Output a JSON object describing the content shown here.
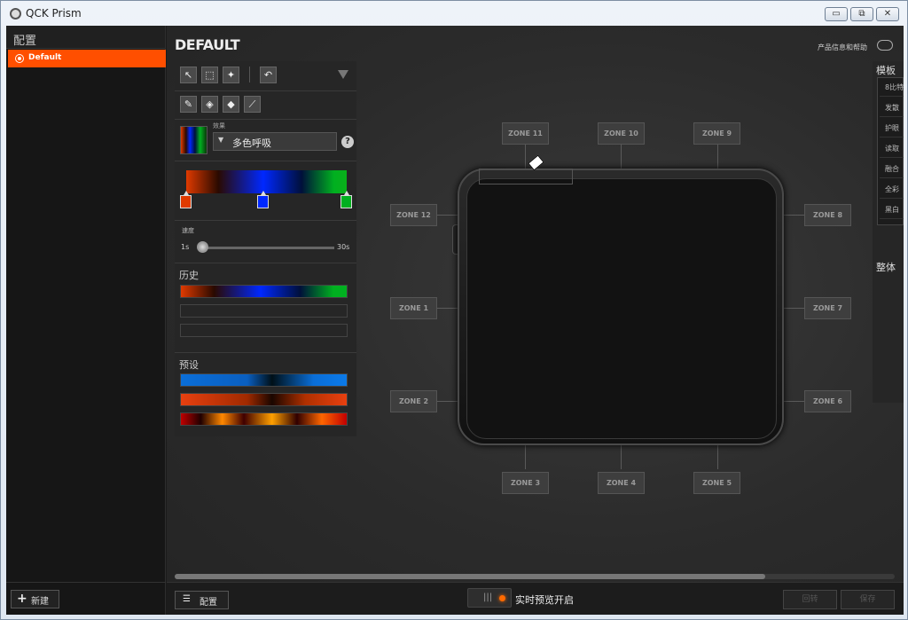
{
  "window": {
    "title": "QCK Prism",
    "minimize": "▭",
    "restore": "⧉",
    "close": "✕"
  },
  "sidebar": {
    "header": "配置",
    "items": [
      {
        "label": "Default",
        "selected": true
      }
    ],
    "new_button": "新建"
  },
  "main": {
    "title": "DEFAULT",
    "help_text": "产品信息和帮助",
    "effect": {
      "label": "效果",
      "value": "多色呼吸",
      "help": "?"
    },
    "gradient_stops": [
      {
        "color": "#e03a00",
        "position": 0.0
      },
      {
        "color": "#0028ff",
        "position": 0.48
      },
      {
        "color": "#00b020",
        "position": 1.0
      }
    ],
    "speed": {
      "label": "速度",
      "min": "1s",
      "max": "30s",
      "value_fraction": 0.0
    },
    "history": {
      "label": "历史"
    },
    "presets": {
      "label": "预设"
    },
    "config_button": "配置",
    "live_preview": "实时预览开启",
    "revert_button": "回转",
    "save_button": "保存",
    "scroll_fraction": 0.82
  },
  "zones": [
    "ZONE 11",
    "ZONE 10",
    "ZONE 9",
    "ZONE 12",
    "ZONE 8",
    "ZONE 1",
    "ZONE 7",
    "ZONE 2",
    "ZONE 6",
    "ZONE 3",
    "ZONE 4",
    "ZONE 5"
  ],
  "right_panel": {
    "title": "模板",
    "items": [
      "8比特",
      "发散",
      "护眼",
      "读取",
      "融合",
      "全彩",
      "黑白"
    ],
    "title2": "整体"
  },
  "colors": {
    "accent": "#ff4f00",
    "background": "#1b1b1b",
    "panel": "#262626"
  }
}
